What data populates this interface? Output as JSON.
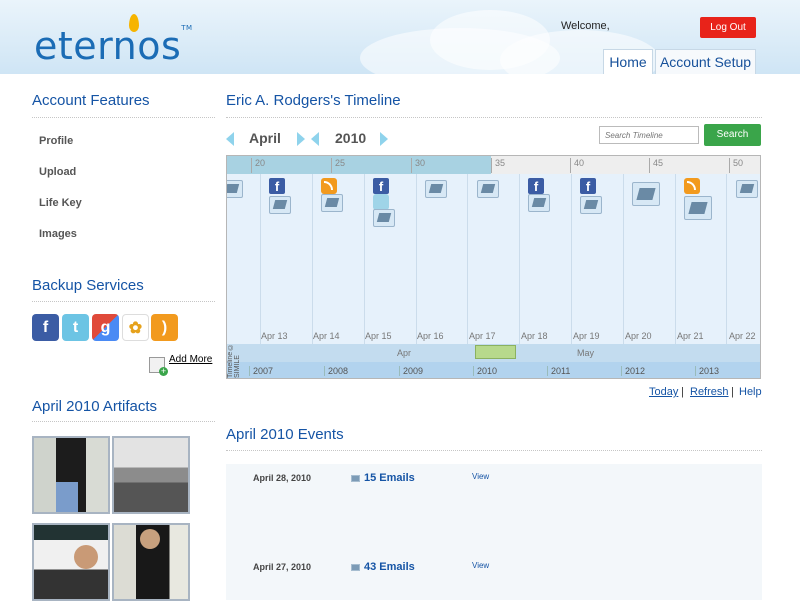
{
  "header": {
    "logo_text": "eternos",
    "logo_tm": "TM",
    "welcome": "Welcome,",
    "logout": "Log Out",
    "tabs": [
      "Home",
      "Account Setup"
    ]
  },
  "sidebar": {
    "account_title": "Account Features",
    "items": [
      "Profile",
      "Upload",
      "Life Key",
      "Images"
    ],
    "backup_title": "Backup Services",
    "services": [
      {
        "icon": "facebook-icon",
        "glyph": "f",
        "color": "#3b5ca4"
      },
      {
        "icon": "twitter-icon",
        "glyph": "t",
        "color": "#6cc4e4"
      },
      {
        "icon": "google-icon",
        "glyph": "g",
        "color": "#4a8af4"
      },
      {
        "icon": "picasa-icon",
        "glyph": "✿",
        "color": "#ffffff"
      },
      {
        "icon": "rss-icon",
        "glyph": ")",
        "color": "#f29a1e"
      }
    ],
    "add_more": "Add More",
    "artifacts_title": "April 2010 Artifacts"
  },
  "timeline": {
    "title": "Eric A. Rodgers's Timeline",
    "month": "April",
    "year": "2010",
    "search_placeholder": "Search Timeline",
    "search_button": "Search",
    "day_ticks": [
      "20",
      "25",
      "30",
      "35",
      "40",
      "45",
      "50"
    ],
    "dates": [
      "Apr 13",
      "Apr 14",
      "Apr 15",
      "Apr 16",
      "Apr 17",
      "Apr 18",
      "Apr 19",
      "Apr 20",
      "Apr 21",
      "Apr 22"
    ],
    "months": [
      "Apr",
      "May"
    ],
    "years": [
      "2007",
      "2008",
      "2009",
      "2010",
      "2011",
      "2012",
      "2013"
    ],
    "credit": "Timeline © SIMILE",
    "links": [
      "Today",
      "Refresh",
      "Help"
    ]
  },
  "events": {
    "title": "April 2010 Events",
    "rows": [
      {
        "date": "April 28, 2010",
        "count": "15 Emails",
        "view": "View"
      },
      {
        "date": "April 27, 2010",
        "count": "43 Emails",
        "view": "View"
      }
    ]
  },
  "colors": {
    "brand": "#1b6cb5",
    "heading": "#1554a5",
    "logout": "#e8231a",
    "search": "#3aa54a"
  }
}
